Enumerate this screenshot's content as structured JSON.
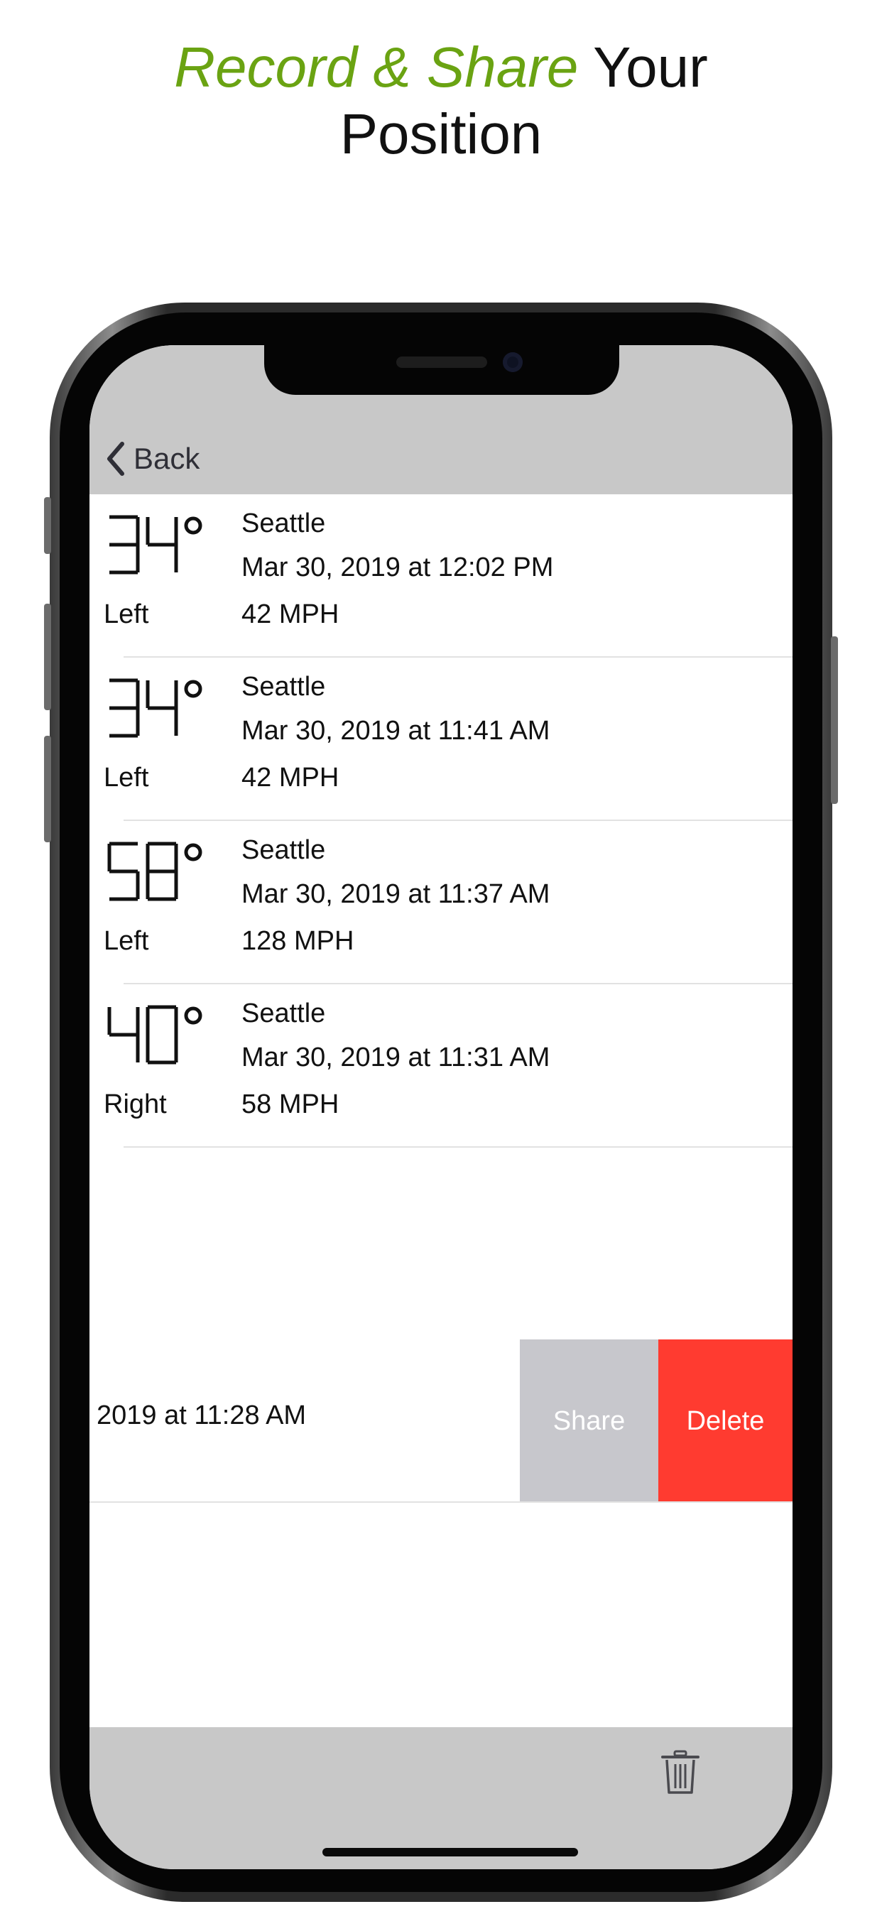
{
  "headline": {
    "accent": "Record & Share",
    "rest1": " Your",
    "line2": "Position"
  },
  "colors": {
    "accent": "#6aa312",
    "navbar": "#c8c8c8",
    "share": "#c7c7cc",
    "delete": "#ff3b30"
  },
  "nav": {
    "back_label": "Back",
    "back_icon": "chevron-left-icon"
  },
  "records": [
    {
      "temp_digits": "34",
      "side": "Left",
      "city": "Seattle",
      "datetime": "Mar 30, 2019 at 12:02 PM",
      "speed": "42 MPH"
    },
    {
      "temp_digits": "34",
      "side": "Left",
      "city": "Seattle",
      "datetime": "Mar 30, 2019 at 11:41 AM",
      "speed": "42 MPH"
    },
    {
      "temp_digits": "58",
      "side": "Left",
      "city": "Seattle",
      "datetime": "Mar 30, 2019 at 11:37 AM",
      "speed": "128 MPH"
    },
    {
      "temp_digits": "40",
      "side": "Right",
      "city": "Seattle",
      "datetime": "Mar 30, 2019 at 11:31 AM",
      "speed": "58 MPH"
    }
  ],
  "swiped_row": {
    "visible_text": "2019 at 11:28 AM",
    "share_label": "Share",
    "delete_label": "Delete"
  },
  "toolbar": {
    "trash_icon": "trash-icon"
  }
}
